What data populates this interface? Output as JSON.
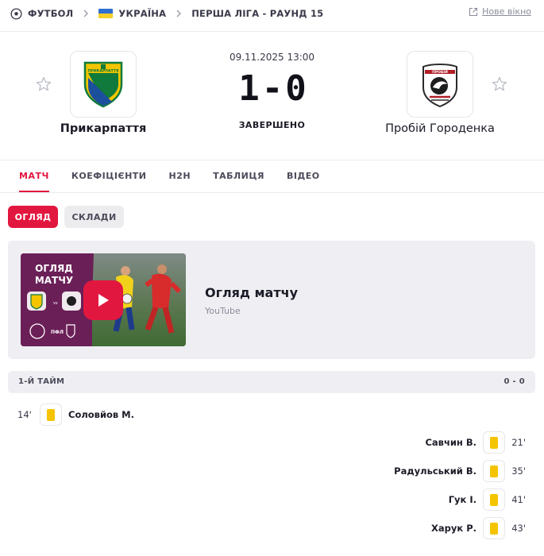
{
  "breadcrumb": {
    "sport": "ФУТБОЛ",
    "country": "УКРАЇНА",
    "league": "ПЕРША ЛІГА - РАУНД 15",
    "new_window": "Нове вікно"
  },
  "match": {
    "datetime": "09.11.2025 13:00",
    "home_score": "1",
    "separator": "-",
    "away_score": "0",
    "status": "ЗАВЕРШЕНО",
    "home": {
      "name": "Прикарпаття",
      "logo_text": "ПРИКАРПАТТЯ"
    },
    "away": {
      "name": "Пробій Городенка",
      "logo_text": "ПРОБІЙ"
    }
  },
  "tabs": [
    "МАТЧ",
    "КОЕФІЦІЄНТИ",
    "H2H",
    "ТАБЛИЦЯ",
    "ВІДЕО"
  ],
  "active_tab": "МАТЧ",
  "subtabs": {
    "review": "ОГЛЯД",
    "lineups": "СКЛАДИ"
  },
  "video": {
    "title": "Огляд матчу",
    "source": "YouTube",
    "thumb_line1": "ОГЛЯД",
    "thumb_line2": "МАТЧУ",
    "thumb_league": "ПФЛ"
  },
  "half": {
    "label": "1-Й ТАЙМ",
    "score": "0 - 0"
  },
  "events": [
    {
      "side": "home",
      "minute": "14'",
      "player": "Соловйов М.",
      "type": "yellow-card"
    },
    {
      "side": "away",
      "minute": "21'",
      "player": "Савчин В.",
      "type": "yellow-card"
    },
    {
      "side": "away",
      "minute": "35'",
      "player": "Радульський В.",
      "type": "yellow-card"
    },
    {
      "side": "away",
      "minute": "41'",
      "player": "Гук І.",
      "type": "yellow-card"
    },
    {
      "side": "away",
      "minute": "43'",
      "player": "Харук Р.",
      "type": "yellow-card"
    }
  ],
  "colors": {
    "accent": "#e2173f",
    "yellow_card": "#f5c400",
    "panel": "#efeff3"
  }
}
